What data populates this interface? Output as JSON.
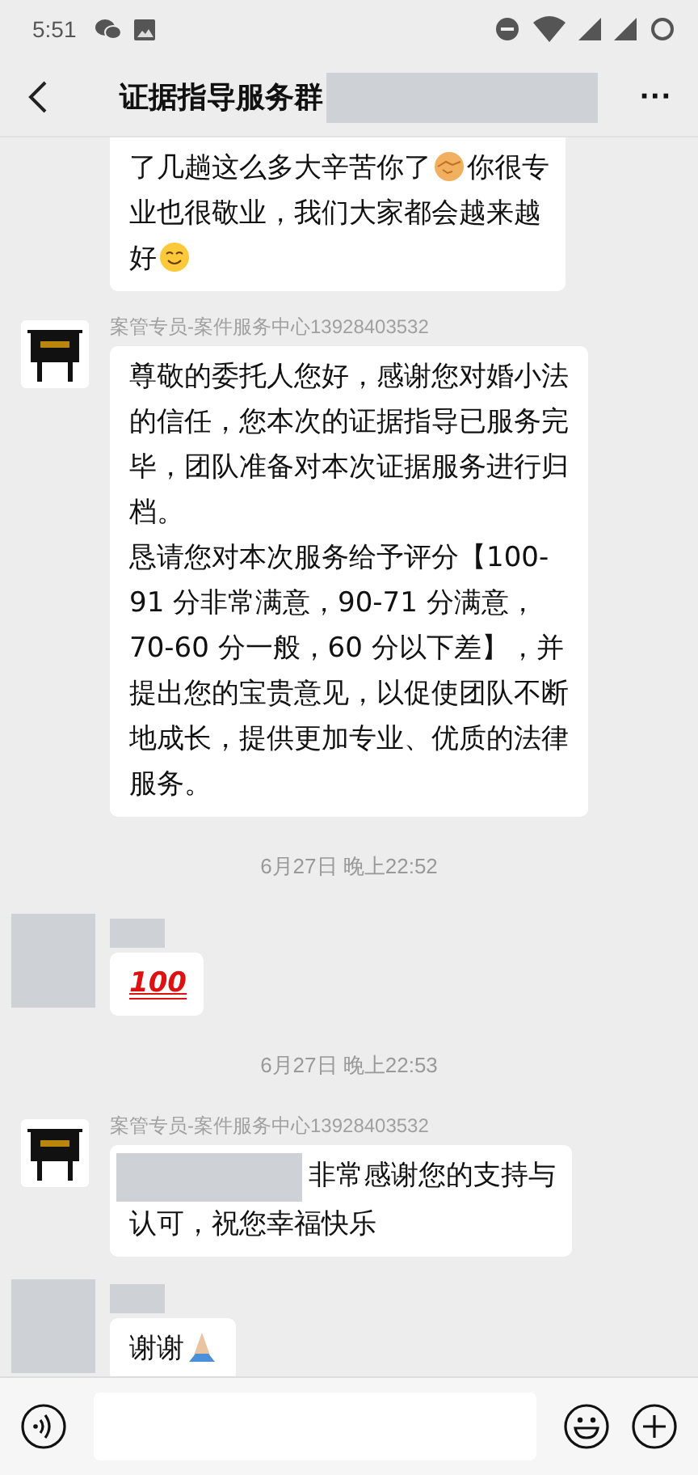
{
  "status_bar": {
    "time": "5:51"
  },
  "header": {
    "title": "证据指导服务群",
    "more": "···"
  },
  "messages": [
    {
      "kind": "message",
      "lines": [
        [
          {
            "kind": "text",
            "text": "了几趟这么多大辛苦你了"
          },
          {
            "kind": "handshake"
          },
          {
            "kind": "text",
            "text": "你很专"
          }
        ],
        [
          {
            "kind": "text",
            "text": "业也很敬业，我们大家都会越来越"
          }
        ],
        [
          {
            "kind": "text",
            "text": "好"
          },
          {
            "kind": "smile"
          }
        ]
      ]
    },
    {
      "kind": "message",
      "avatar": {
        "kind": "logo"
      },
      "sender": "案管专员-案件服务中心13928403532",
      "lines": [
        [
          {
            "kind": "text",
            "text": "尊敬的委托人您好，感谢您对婚小法的信任，您本次的证据指导已服务完毕，团队准备对本次证据服务进行归档。"
          }
        ],
        [
          {
            "kind": "text",
            "text": "恳请您对本次服务给予评分【100-91 分非常满意，90-71 分满意，70-60 分一般，60 分以下差】，并提出您的宝贵意见，以促使团队不断地成长，提供更加专业、优质的法律服务。"
          }
        ]
      ]
    },
    {
      "kind": "time",
      "text": "6月27日 晚上22:52"
    },
    {
      "kind": "message",
      "avatar": {
        "kind": "redacted"
      },
      "lines": [
        [
          {
            "kind": "hundred",
            "text": "100"
          }
        ]
      ]
    },
    {
      "kind": "time",
      "text": "6月27日 晚上22:53"
    },
    {
      "kind": "message",
      "avatar": {
        "kind": "logo"
      },
      "sender": "案管专员-案件服务中心13928403532",
      "lines": [
        [
          {
            "kind": "redacted"
          },
          {
            "kind": "text",
            "text": "非常感谢您的支持与"
          }
        ],
        [
          {
            "kind": "text",
            "text": "认可，祝您幸福快乐"
          }
        ]
      ]
    },
    {
      "kind": "message",
      "avatar": {
        "kind": "redacted"
      },
      "lines": [
        [
          {
            "kind": "text",
            "text": "谢谢"
          },
          {
            "kind": "pray"
          }
        ]
      ]
    }
  ]
}
